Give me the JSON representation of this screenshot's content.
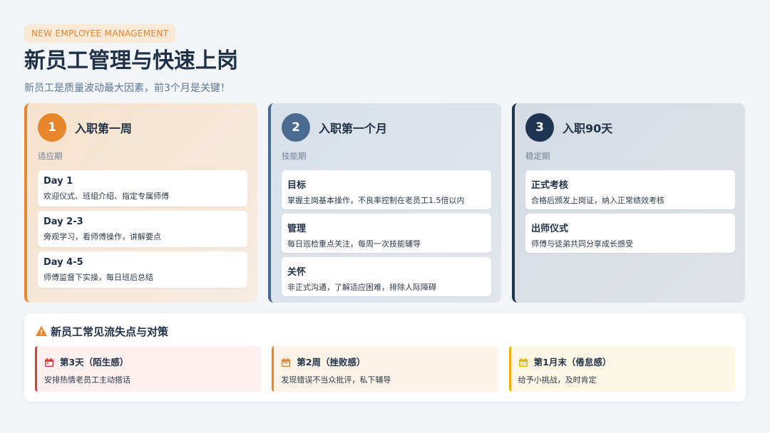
{
  "header": {
    "tag": "NEW EMPLOYEE MANAGEMENT",
    "title": "新员工管理与快速上岗",
    "subtitle": "新员工是质量波动最大因素，前3个月是关键！"
  },
  "stages": [
    {
      "number": "1",
      "title": "入职第一周",
      "period": "适应期",
      "color": "#e8862c",
      "items": [
        {
          "title": "Day 1",
          "desc": "欢迎仪式、班组介绍、指定专属师傅"
        },
        {
          "title": "Day 2-3",
          "desc": "旁观学习，看师傅操作，讲解要点"
        },
        {
          "title": "Day 4-5",
          "desc": "师傅监督下实操，每日班后总结"
        }
      ]
    },
    {
      "number": "2",
      "title": "入职第一个月",
      "period": "技能期",
      "color": "#4b6a8f",
      "items": [
        {
          "title": "目标",
          "desc": "掌握主岗基本操作，不良率控制在老员工1.5倍以内"
        },
        {
          "title": "管理",
          "desc": "每日巡检重点关注，每周一次技能辅导"
        },
        {
          "title": "关怀",
          "desc": "非正式沟通，了解适应困难，排除人际障碍"
        }
      ]
    },
    {
      "number": "3",
      "title": "入职90天",
      "period": "稳定期",
      "color": "#1d3551",
      "items": [
        {
          "title": "正式考核",
          "desc": "合格后颁发上岗证，纳入正常绩效考核"
        },
        {
          "title": "出师仪式",
          "desc": "师傅与徒弟共同分享成长感受"
        }
      ]
    }
  ],
  "risks": {
    "icon": "warning-icon",
    "title": "新员工常见流失点与对策",
    "cards": [
      {
        "title": "第3天（陌生感）",
        "desc": "安排热情老员工主动搭话",
        "color": "#e0383e",
        "icon": "calendar-icon"
      },
      {
        "title": "第2周（挫败感）",
        "desc": "发现错误不当众批评，私下辅导",
        "color": "#e8862c",
        "icon": "calendar-icon"
      },
      {
        "title": "第1月末（倦怠感）",
        "desc": "给予小挑战，及时肯定",
        "color": "#eab308",
        "icon": "calendar-icon"
      }
    ]
  }
}
